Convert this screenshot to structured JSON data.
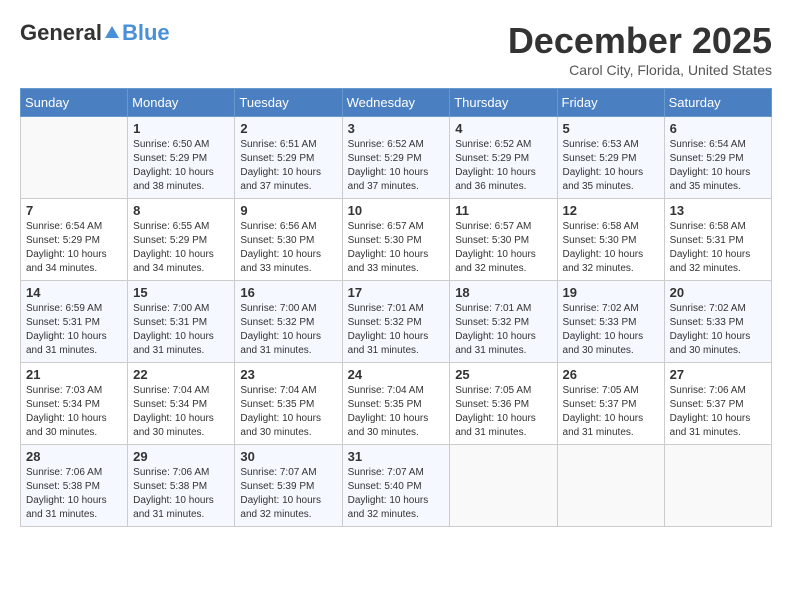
{
  "header": {
    "logo_general": "General",
    "logo_blue": "Blue",
    "month": "December 2025",
    "location": "Carol City, Florida, United States"
  },
  "weekdays": [
    "Sunday",
    "Monday",
    "Tuesday",
    "Wednesday",
    "Thursday",
    "Friday",
    "Saturday"
  ],
  "weeks": [
    [
      {
        "day": "",
        "info": ""
      },
      {
        "day": "1",
        "info": "Sunrise: 6:50 AM\nSunset: 5:29 PM\nDaylight: 10 hours\nand 38 minutes."
      },
      {
        "day": "2",
        "info": "Sunrise: 6:51 AM\nSunset: 5:29 PM\nDaylight: 10 hours\nand 37 minutes."
      },
      {
        "day": "3",
        "info": "Sunrise: 6:52 AM\nSunset: 5:29 PM\nDaylight: 10 hours\nand 37 minutes."
      },
      {
        "day": "4",
        "info": "Sunrise: 6:52 AM\nSunset: 5:29 PM\nDaylight: 10 hours\nand 36 minutes."
      },
      {
        "day": "5",
        "info": "Sunrise: 6:53 AM\nSunset: 5:29 PM\nDaylight: 10 hours\nand 35 minutes."
      },
      {
        "day": "6",
        "info": "Sunrise: 6:54 AM\nSunset: 5:29 PM\nDaylight: 10 hours\nand 35 minutes."
      }
    ],
    [
      {
        "day": "7",
        "info": "Sunrise: 6:54 AM\nSunset: 5:29 PM\nDaylight: 10 hours\nand 34 minutes."
      },
      {
        "day": "8",
        "info": "Sunrise: 6:55 AM\nSunset: 5:29 PM\nDaylight: 10 hours\nand 34 minutes."
      },
      {
        "day": "9",
        "info": "Sunrise: 6:56 AM\nSunset: 5:30 PM\nDaylight: 10 hours\nand 33 minutes."
      },
      {
        "day": "10",
        "info": "Sunrise: 6:57 AM\nSunset: 5:30 PM\nDaylight: 10 hours\nand 33 minutes."
      },
      {
        "day": "11",
        "info": "Sunrise: 6:57 AM\nSunset: 5:30 PM\nDaylight: 10 hours\nand 32 minutes."
      },
      {
        "day": "12",
        "info": "Sunrise: 6:58 AM\nSunset: 5:30 PM\nDaylight: 10 hours\nand 32 minutes."
      },
      {
        "day": "13",
        "info": "Sunrise: 6:58 AM\nSunset: 5:31 PM\nDaylight: 10 hours\nand 32 minutes."
      }
    ],
    [
      {
        "day": "14",
        "info": "Sunrise: 6:59 AM\nSunset: 5:31 PM\nDaylight: 10 hours\nand 31 minutes."
      },
      {
        "day": "15",
        "info": "Sunrise: 7:00 AM\nSunset: 5:31 PM\nDaylight: 10 hours\nand 31 minutes."
      },
      {
        "day": "16",
        "info": "Sunrise: 7:00 AM\nSunset: 5:32 PM\nDaylight: 10 hours\nand 31 minutes."
      },
      {
        "day": "17",
        "info": "Sunrise: 7:01 AM\nSunset: 5:32 PM\nDaylight: 10 hours\nand 31 minutes."
      },
      {
        "day": "18",
        "info": "Sunrise: 7:01 AM\nSunset: 5:32 PM\nDaylight: 10 hours\nand 31 minutes."
      },
      {
        "day": "19",
        "info": "Sunrise: 7:02 AM\nSunset: 5:33 PM\nDaylight: 10 hours\nand 30 minutes."
      },
      {
        "day": "20",
        "info": "Sunrise: 7:02 AM\nSunset: 5:33 PM\nDaylight: 10 hours\nand 30 minutes."
      }
    ],
    [
      {
        "day": "21",
        "info": "Sunrise: 7:03 AM\nSunset: 5:34 PM\nDaylight: 10 hours\nand 30 minutes."
      },
      {
        "day": "22",
        "info": "Sunrise: 7:04 AM\nSunset: 5:34 PM\nDaylight: 10 hours\nand 30 minutes."
      },
      {
        "day": "23",
        "info": "Sunrise: 7:04 AM\nSunset: 5:35 PM\nDaylight: 10 hours\nand 30 minutes."
      },
      {
        "day": "24",
        "info": "Sunrise: 7:04 AM\nSunset: 5:35 PM\nDaylight: 10 hours\nand 30 minutes."
      },
      {
        "day": "25",
        "info": "Sunrise: 7:05 AM\nSunset: 5:36 PM\nDaylight: 10 hours\nand 31 minutes."
      },
      {
        "day": "26",
        "info": "Sunrise: 7:05 AM\nSunset: 5:37 PM\nDaylight: 10 hours\nand 31 minutes."
      },
      {
        "day": "27",
        "info": "Sunrise: 7:06 AM\nSunset: 5:37 PM\nDaylight: 10 hours\nand 31 minutes."
      }
    ],
    [
      {
        "day": "28",
        "info": "Sunrise: 7:06 AM\nSunset: 5:38 PM\nDaylight: 10 hours\nand 31 minutes."
      },
      {
        "day": "29",
        "info": "Sunrise: 7:06 AM\nSunset: 5:38 PM\nDaylight: 10 hours\nand 31 minutes."
      },
      {
        "day": "30",
        "info": "Sunrise: 7:07 AM\nSunset: 5:39 PM\nDaylight: 10 hours\nand 32 minutes."
      },
      {
        "day": "31",
        "info": "Sunrise: 7:07 AM\nSunset: 5:40 PM\nDaylight: 10 hours\nand 32 minutes."
      },
      {
        "day": "",
        "info": ""
      },
      {
        "day": "",
        "info": ""
      },
      {
        "day": "",
        "info": ""
      }
    ]
  ]
}
